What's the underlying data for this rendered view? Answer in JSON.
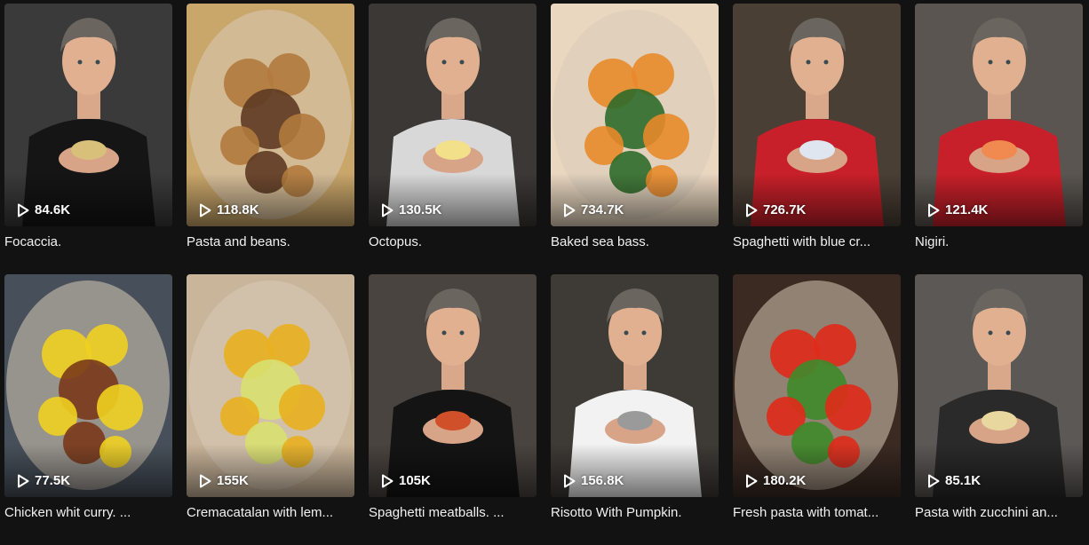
{
  "videos": [
    {
      "title": "Focaccia.",
      "views": "84.6K",
      "scene": "person",
      "bg": "#3a3a3a",
      "shirt": "#151515",
      "accent": "#d9c07a"
    },
    {
      "title": "Pasta and beans.",
      "views": "118.8K",
      "scene": "food",
      "bg": "#c9a66a",
      "food": "#b07a3c",
      "accent": "#5e3a22"
    },
    {
      "title": "Octopus.",
      "views": "130.5K",
      "scene": "person",
      "bg": "#3b3836",
      "shirt": "#d8d8d8",
      "accent": "#f3e08a"
    },
    {
      "title": "Baked sea bass.",
      "views": "734.7K",
      "scene": "food",
      "bg": "#e9d7c0",
      "food": "#e88a2a",
      "accent": "#2f6b2a"
    },
    {
      "title": "Spaghetti with blue cr...",
      "views": "726.7K",
      "scene": "person",
      "bg": "#4a3f35",
      "shirt": "#c8202a",
      "accent": "#dfe6f0"
    },
    {
      "title": "Nigiri.",
      "views": "121.4K",
      "scene": "person",
      "bg": "#5a5550",
      "shirt": "#c8202a",
      "accent": "#f08a50"
    },
    {
      "title": "Chicken whit curry. ...",
      "views": "77.5K",
      "scene": "food",
      "bg": "#47505a",
      "food": "#f0d020",
      "accent": "#7a3a1a"
    },
    {
      "title": "Cremacatalan with lem...",
      "views": "155K",
      "scene": "food",
      "bg": "#c9b59a",
      "food": "#e8b020",
      "accent": "#d8e070"
    },
    {
      "title": "Spaghetti meatballs. ...",
      "views": "105K",
      "scene": "person",
      "bg": "#4a4440",
      "shirt": "#141414",
      "accent": "#d0502a"
    },
    {
      "title": "Risotto With Pumpkin.",
      "views": "156.8K",
      "scene": "person",
      "bg": "#3e3a36",
      "shirt": "#f2f2f2",
      "accent": "#9a9a9a"
    },
    {
      "title": "Fresh pasta with tomat...",
      "views": "180.2K",
      "scene": "food",
      "bg": "#3a2a22",
      "food": "#e02a1a",
      "accent": "#3f8a2a"
    },
    {
      "title": "Pasta with zucchini an...",
      "views": "85.1K",
      "scene": "person",
      "bg": "#5c5856",
      "shirt": "#2a2a2a",
      "accent": "#e8d8a0"
    }
  ]
}
